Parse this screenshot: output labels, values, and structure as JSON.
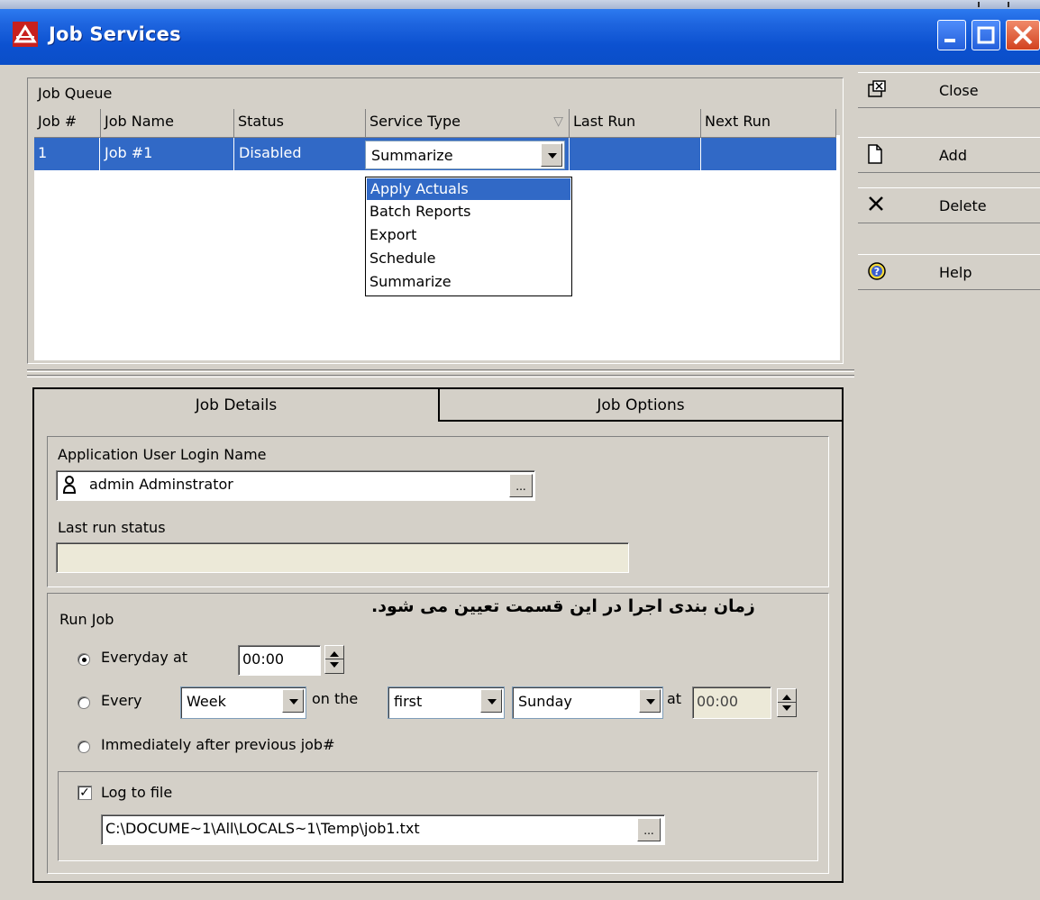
{
  "window": {
    "title": "Job Services",
    "icon": "adobe-like-app-icon"
  },
  "queue": {
    "title": "Job Queue",
    "columns": [
      "Job #",
      "Job Name",
      "Status",
      "Service Type",
      "Last Run",
      "Next Run"
    ],
    "rows": [
      {
        "job_no": "1",
        "name": "Job #1",
        "status": "Disabled",
        "service_type": "Summarize",
        "last_run": "",
        "next_run": ""
      }
    ],
    "service_options": [
      "Apply Actuals",
      "Batch Reports",
      "Export",
      "Schedule",
      "Summarize"
    ],
    "highlighted_option": "Apply Actuals"
  },
  "tabs": {
    "details": "Job Details",
    "options": "Job Options"
  },
  "details": {
    "login_label": "Application User Login Name",
    "login_value": "admin Adminstrator",
    "ellipsis": "...",
    "last_run_label": "Last run status",
    "last_run_value": ""
  },
  "run_job": {
    "title": "Run Job",
    "annotation": "زمان بندی اجرا در این قسمت تعیین می شود.",
    "everyday_label": "Everyday at",
    "everyday_time": "00:00",
    "every_label": "Every",
    "period": "Week",
    "on_the": "on the",
    "ordinal": "first",
    "weekday": "Sunday",
    "at": "at",
    "every_time": "00:00",
    "immediately_label": "Immediately after previous job#",
    "selected": "everyday"
  },
  "log": {
    "label": "Log to file",
    "checked": true,
    "check_mark": "✓",
    "path": "C:\\DOCUME~1\\All\\LOCALS~1\\Temp\\job1.txt",
    "ellipsis": "..."
  },
  "sidebar": {
    "close": "Close",
    "add": "Add",
    "delete": "Delete",
    "help": "Help"
  },
  "colors": {
    "titlebar": "#0c51d0",
    "selection": "#3169c6",
    "face": "#d4d0c8"
  }
}
